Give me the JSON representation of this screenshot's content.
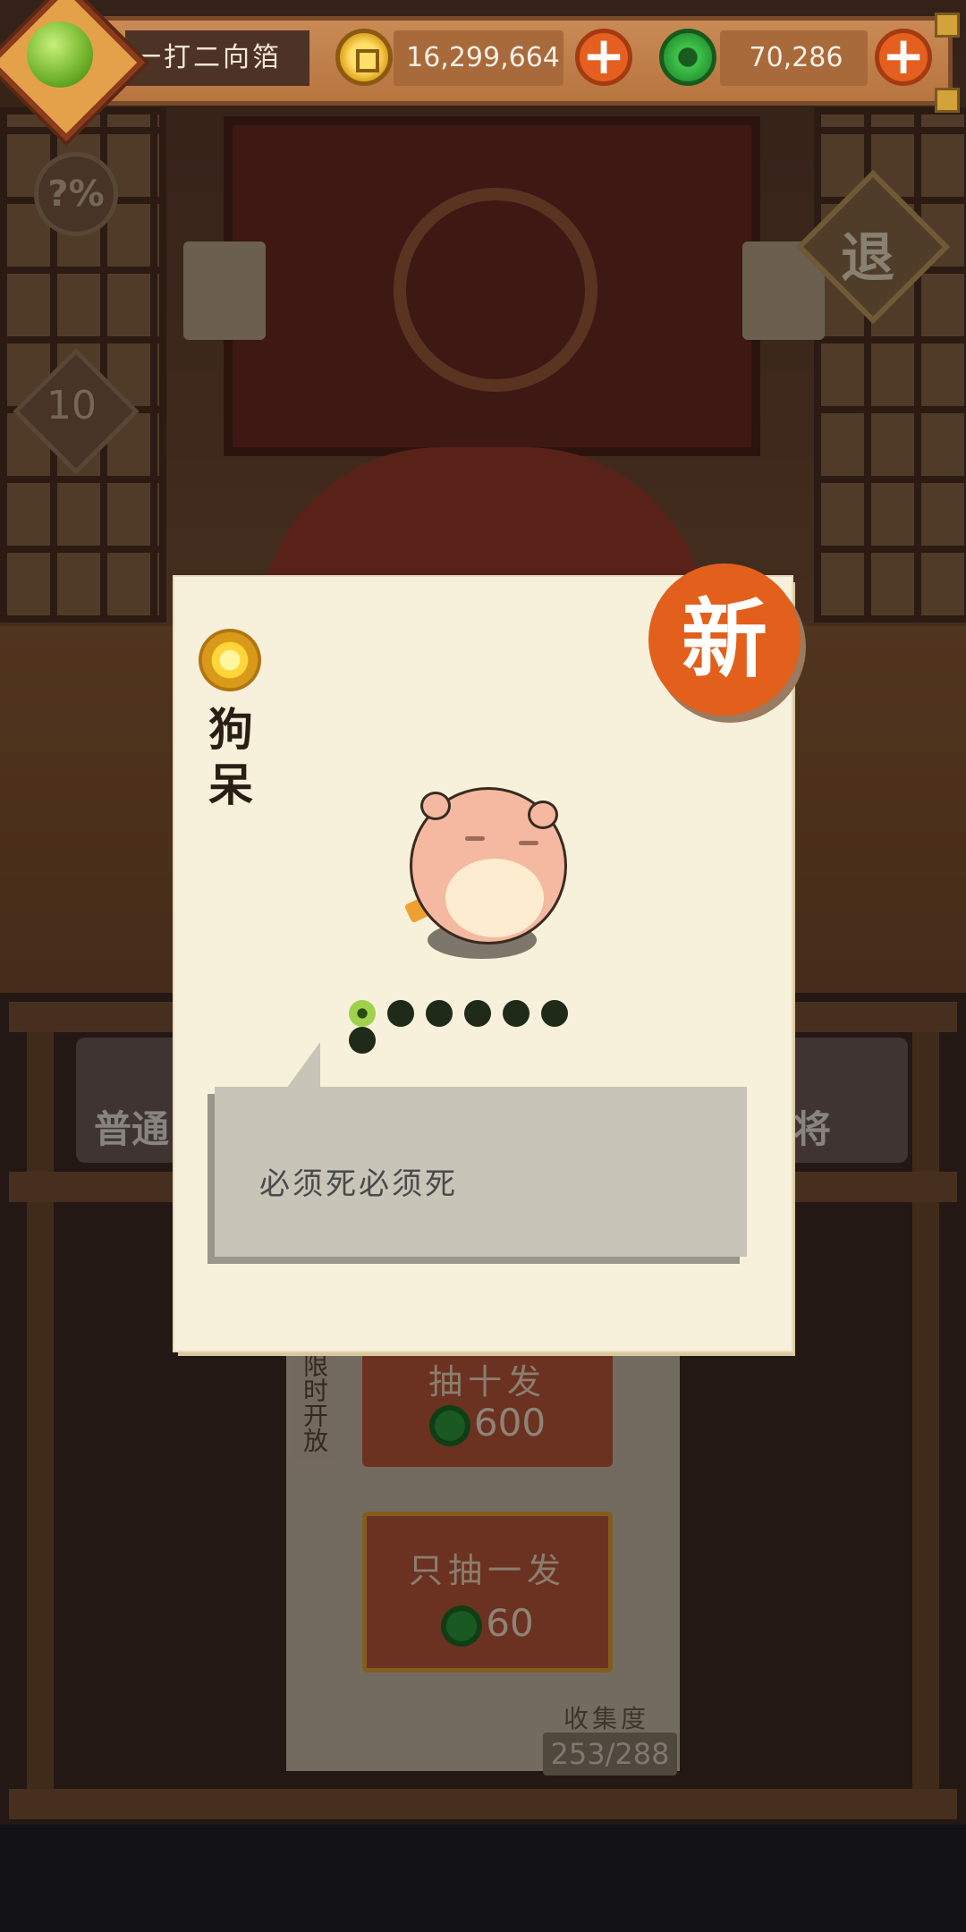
{
  "hud": {
    "player_name": "一打二向箔",
    "gold_amount": "16,299,664",
    "jade_amount": "70,286",
    "add_gold_label": "+",
    "add_jade_label": "+"
  },
  "background": {
    "odds_label": "?%",
    "level_badge": "10",
    "retreat_label": "退",
    "normal_pool_label": "普通",
    "special_pool_label": "林将",
    "limited_label": "限时开放",
    "draw_ten_label": "抽十发",
    "draw_ten_price": "600",
    "draw_one_label": "只抽一发",
    "draw_one_price": "60",
    "collection_label": "收集度",
    "collection_count": "253/288"
  },
  "card": {
    "new_badge": "新",
    "character_name": "狗呆",
    "rarity_dots_total": 7,
    "rarity_dots_lit": 1,
    "quote": "必须死必须死"
  },
  "colors": {
    "new_badge": "#e2601c",
    "card_bg": "#f7f0da",
    "speech_bg": "#c8c4b8"
  }
}
